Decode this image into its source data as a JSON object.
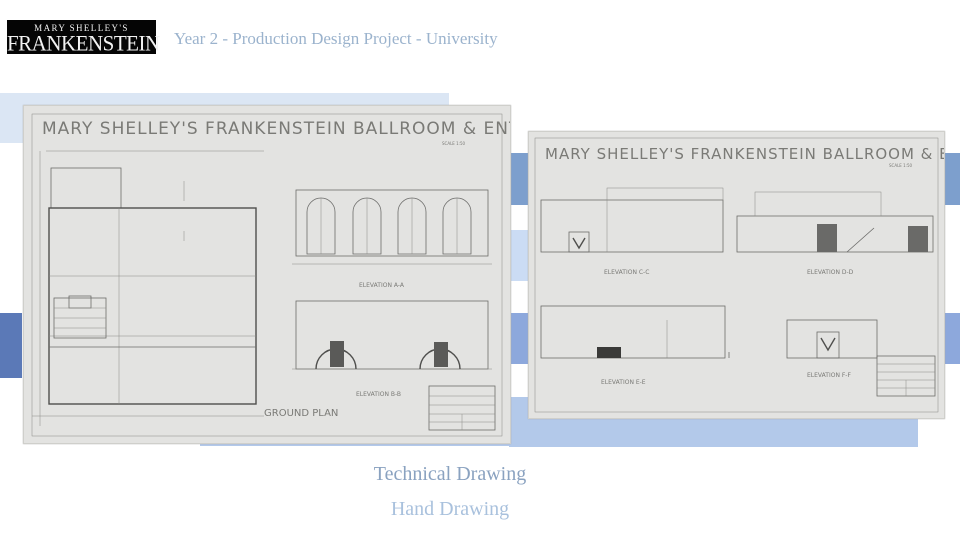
{
  "header": {
    "logo": {
      "line1": "MARY SHELLEY'S",
      "line2": "FRANKENSTEIN"
    },
    "title": "Year 2 -  Production Design Project  - University"
  },
  "drawings": {
    "sheet1": {
      "title": "MARY SHELLEY'S FRANKENSTEIN   BALLROOM & ENTRANCE",
      "scale": "SCALE 1:50",
      "elevation_top": "ELEVATION A-A",
      "elevation_bottom": "ELEVATION B-B",
      "plan_label": "GROUND PLAN"
    },
    "sheet2": {
      "title": "MARY SHELLEY'S FRANKENSTEIN   BALLROOM & ENTRANCE",
      "scale": "SCALE 1:50",
      "elev_1": "ELEVATION C-C",
      "elev_2": "ELEVATION D-D",
      "elev_3": "ELEVATION E-E",
      "elev_4": "ELEVATION F-F"
    }
  },
  "captions": {
    "primary": "Technical Drawing",
    "secondary": "Hand Drawing"
  },
  "colors": {
    "title_text": "#9bb3cd",
    "caption_primary": "#8aa2c0",
    "caption_secondary": "#a9c1dd",
    "accent_light": "#dbe6f4",
    "accent_mid": "#b3c9ea",
    "accent_dark": "#5b79b7"
  }
}
